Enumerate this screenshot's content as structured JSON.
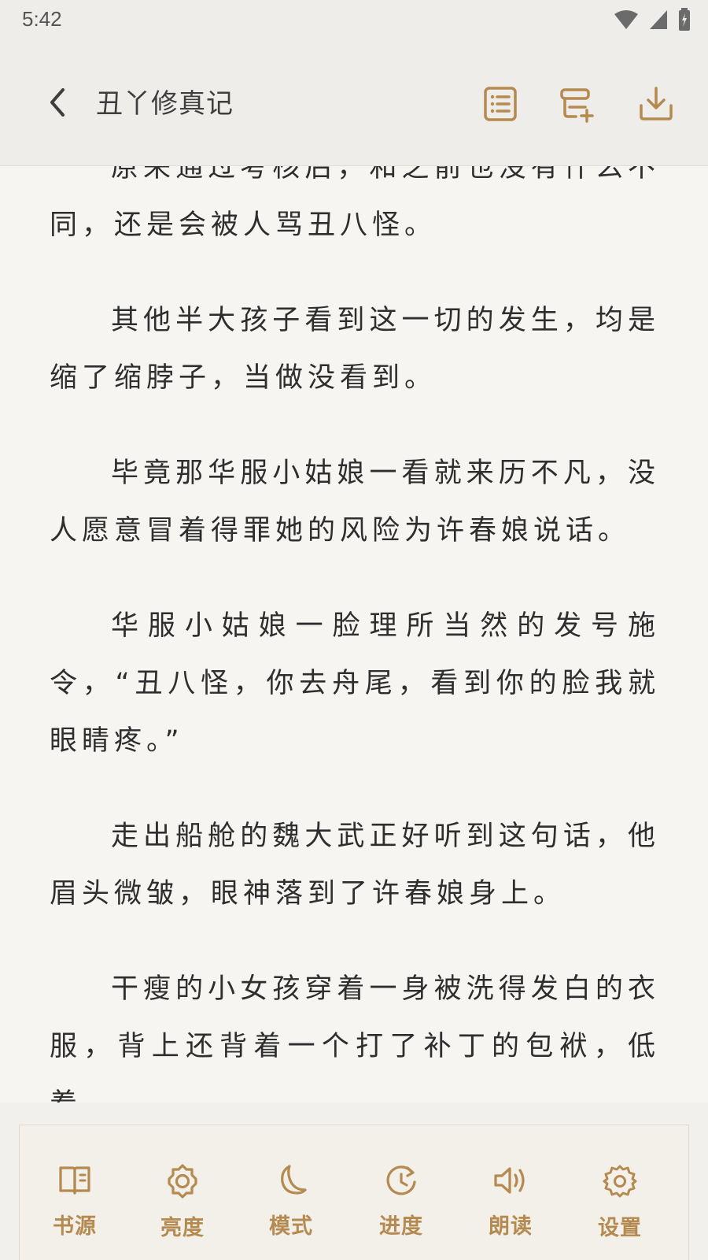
{
  "status": {
    "time": "5:42"
  },
  "header": {
    "title": "丑丫修真记"
  },
  "content": {
    "paragraphs": [
      "原来通过考核后，和之前也没有什么不同，还是会被人骂丑八怪。",
      "其他半大孩子看到这一切的发生，均是缩了缩脖子，当做没看到。",
      "毕竟那华服小姑娘一看就来历不凡，没人愿意冒着得罪她的风险为许春娘说话。",
      "华服小姑娘一脸理所当然的发号施令，“丑八怪，你去舟尾，看到你的脸我就眼睛疼。”",
      "走出船舱的魏大武正好听到这句话，他眉头微皱，眼神落到了许春娘身上。",
      "干瘦的小女孩穿着一身被洗得发白的衣服，背上还背着一个打了补丁的包袱，低着"
    ]
  },
  "toolbar": {
    "items": [
      {
        "label": "书源",
        "icon": "book-source-icon"
      },
      {
        "label": "亮度",
        "icon": "brightness-icon"
      },
      {
        "label": "模式",
        "icon": "moon-icon"
      },
      {
        "label": "进度",
        "icon": "progress-icon"
      },
      {
        "label": "朗读",
        "icon": "speaker-icon"
      },
      {
        "label": "设置",
        "icon": "settings-icon"
      }
    ]
  },
  "colors": {
    "accent": "#b58a50",
    "text": "#2e2e2e",
    "background": "#f7f5f2"
  }
}
